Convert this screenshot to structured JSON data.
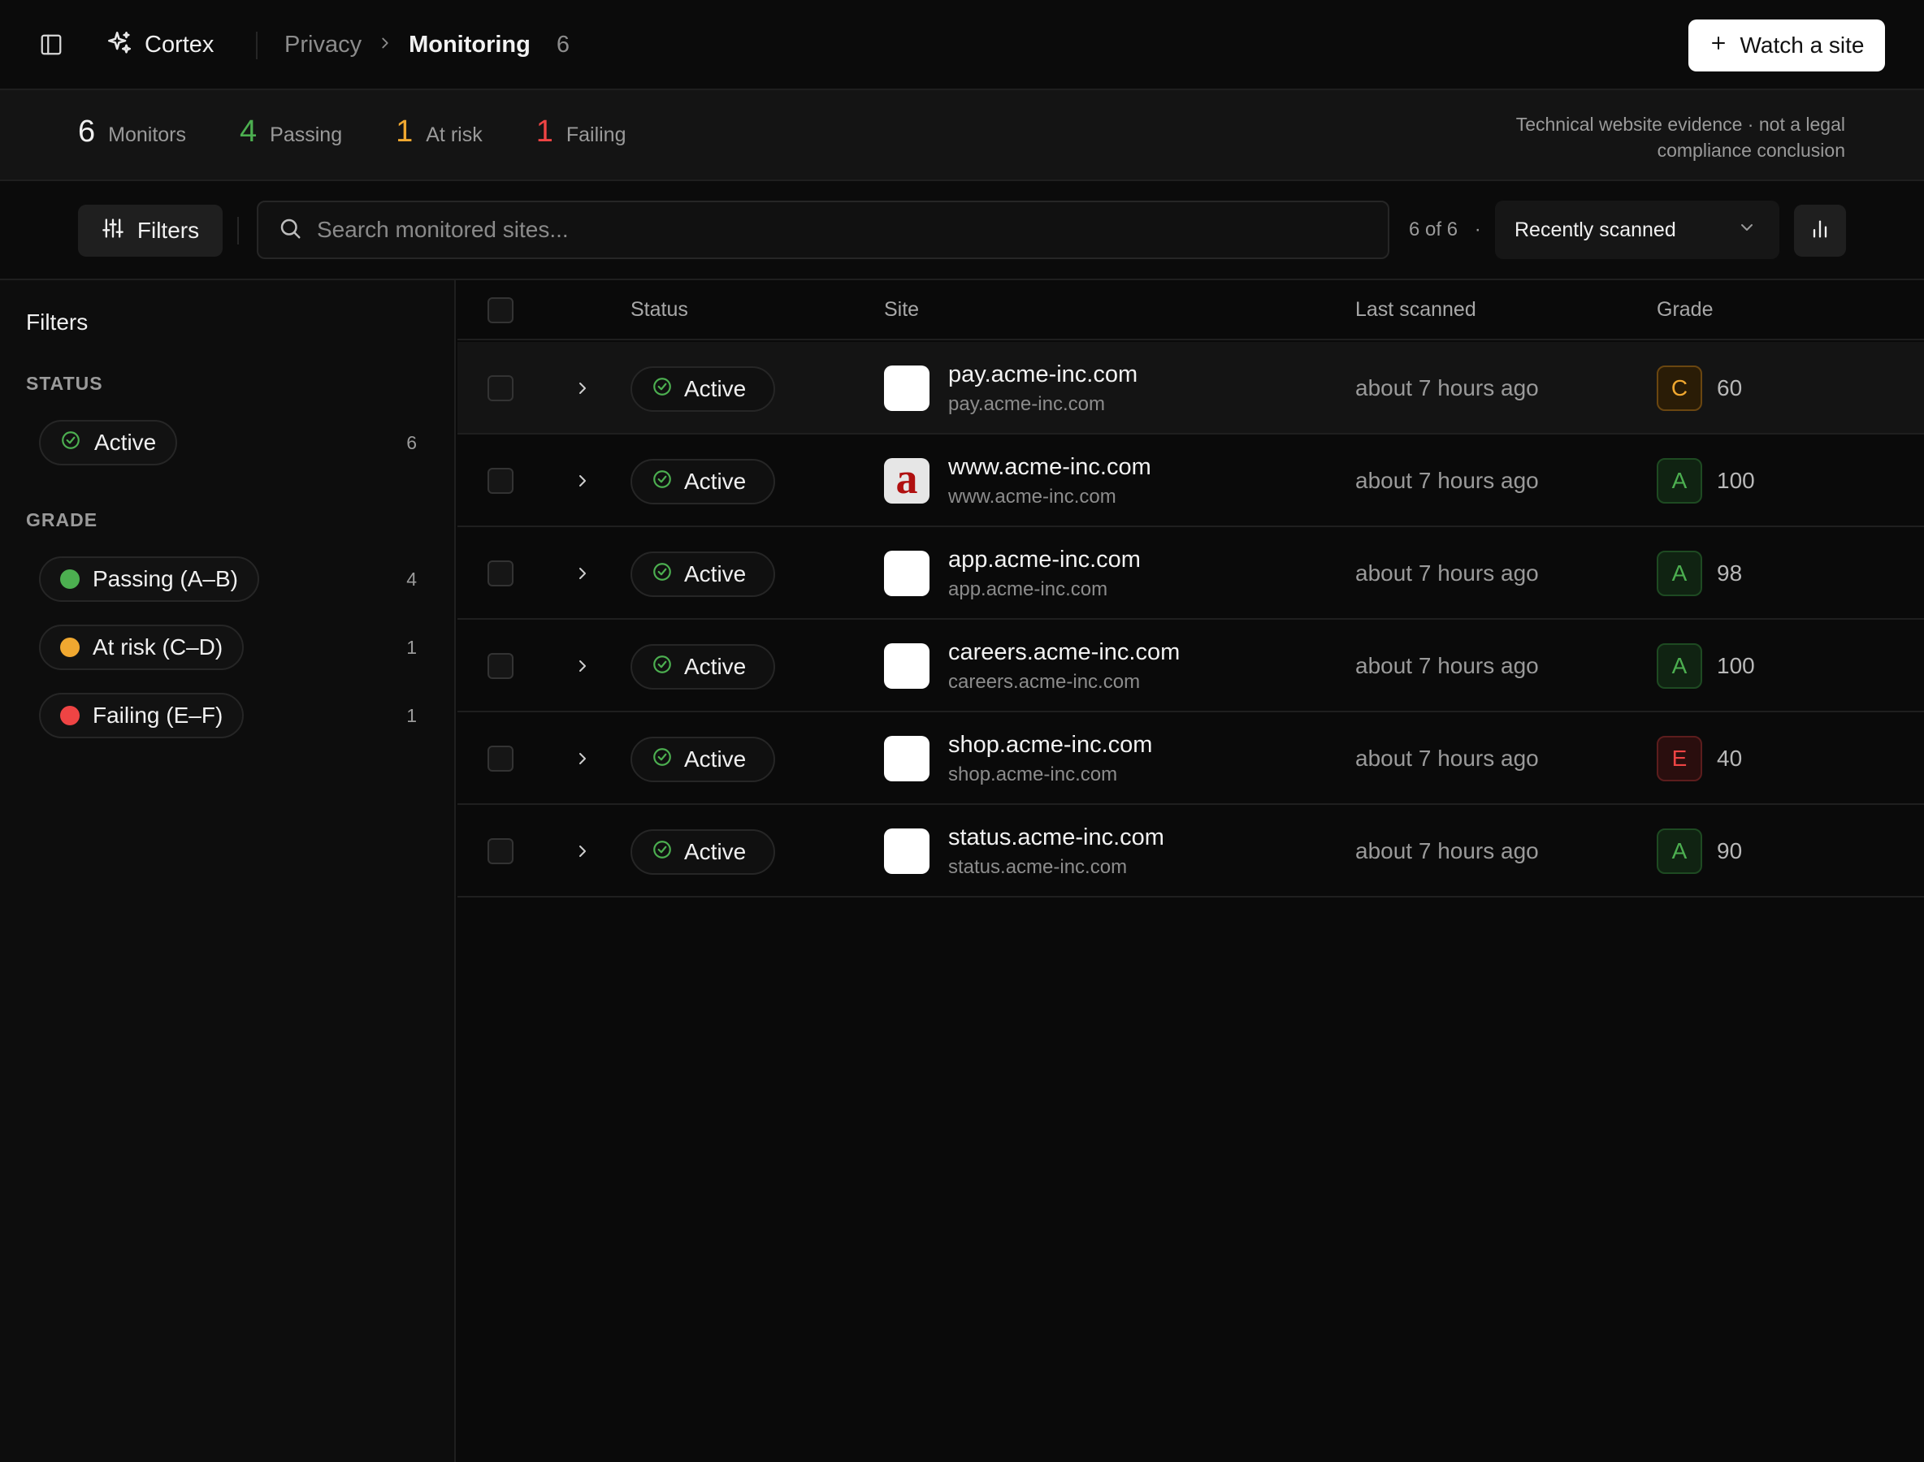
{
  "header": {
    "brand": "Cortex",
    "breadcrumb_parent": "Privacy",
    "breadcrumb_current": "Monitoring",
    "breadcrumb_count": "6",
    "watch_button": "Watch a site"
  },
  "stats": {
    "monitors": {
      "value": "6",
      "label": "Monitors",
      "color": "#f0f0f0"
    },
    "passing": {
      "value": "4",
      "label": "Passing",
      "color": "#4caf50"
    },
    "at_risk": {
      "value": "1",
      "label": "At risk",
      "color": "#f0a830"
    },
    "failing": {
      "value": "1",
      "label": "Failing",
      "color": "#ef4444"
    },
    "disclaimer": "Technical website evidence · not a legal compliance conclusion"
  },
  "toolbar": {
    "filters_label": "Filters",
    "search_placeholder": "Search monitored sites...",
    "result_count": "6 of 6",
    "result_separator": "·",
    "sort_value": "Recently scanned"
  },
  "sidebar": {
    "title": "Filters",
    "status_heading": "STATUS",
    "status_items": [
      {
        "label": "Active",
        "count": "6",
        "icon": "check-circle-icon"
      }
    ],
    "grade_heading": "GRADE",
    "grade_items": [
      {
        "label": "Passing (A–B)",
        "count": "4",
        "color": "#4caf50"
      },
      {
        "label": "At risk (C–D)",
        "count": "1",
        "color": "#f0a830"
      },
      {
        "label": "Failing (E–F)",
        "count": "1",
        "color": "#ef4444"
      }
    ]
  },
  "table": {
    "columns": {
      "status": "Status",
      "site": "Site",
      "last_scanned": "Last scanned",
      "grade": "Grade"
    },
    "rows": [
      {
        "status": "Active",
        "name": "pay.acme-inc.com",
        "url": "pay.acme-inc.com",
        "scanned": "about 7 hours ago",
        "grade": "C",
        "score": "60",
        "favicon": "blank"
      },
      {
        "status": "Active",
        "name": "www.acme-inc.com",
        "url": "www.acme-inc.com",
        "scanned": "about 7 hours ago",
        "grade": "A",
        "score": "100",
        "favicon": "acme-logo",
        "favicon_letter": "a"
      },
      {
        "status": "Active",
        "name": "app.acme-inc.com",
        "url": "app.acme-inc.com",
        "scanned": "about 7 hours ago",
        "grade": "A",
        "score": "98",
        "favicon": "blank"
      },
      {
        "status": "Active",
        "name": "careers.acme-inc.com",
        "url": "careers.acme-inc.com",
        "scanned": "about 7 hours ago",
        "grade": "A",
        "score": "100",
        "favicon": "blank"
      },
      {
        "status": "Active",
        "name": "shop.acme-inc.com",
        "url": "shop.acme-inc.com",
        "scanned": "about 7 hours ago",
        "grade": "E",
        "score": "40",
        "favicon": "blank"
      },
      {
        "status": "Active",
        "name": "status.acme-inc.com",
        "url": "status.acme-inc.com",
        "scanned": "about 7 hours ago",
        "grade": "A",
        "score": "90",
        "favicon": "blank"
      }
    ]
  }
}
